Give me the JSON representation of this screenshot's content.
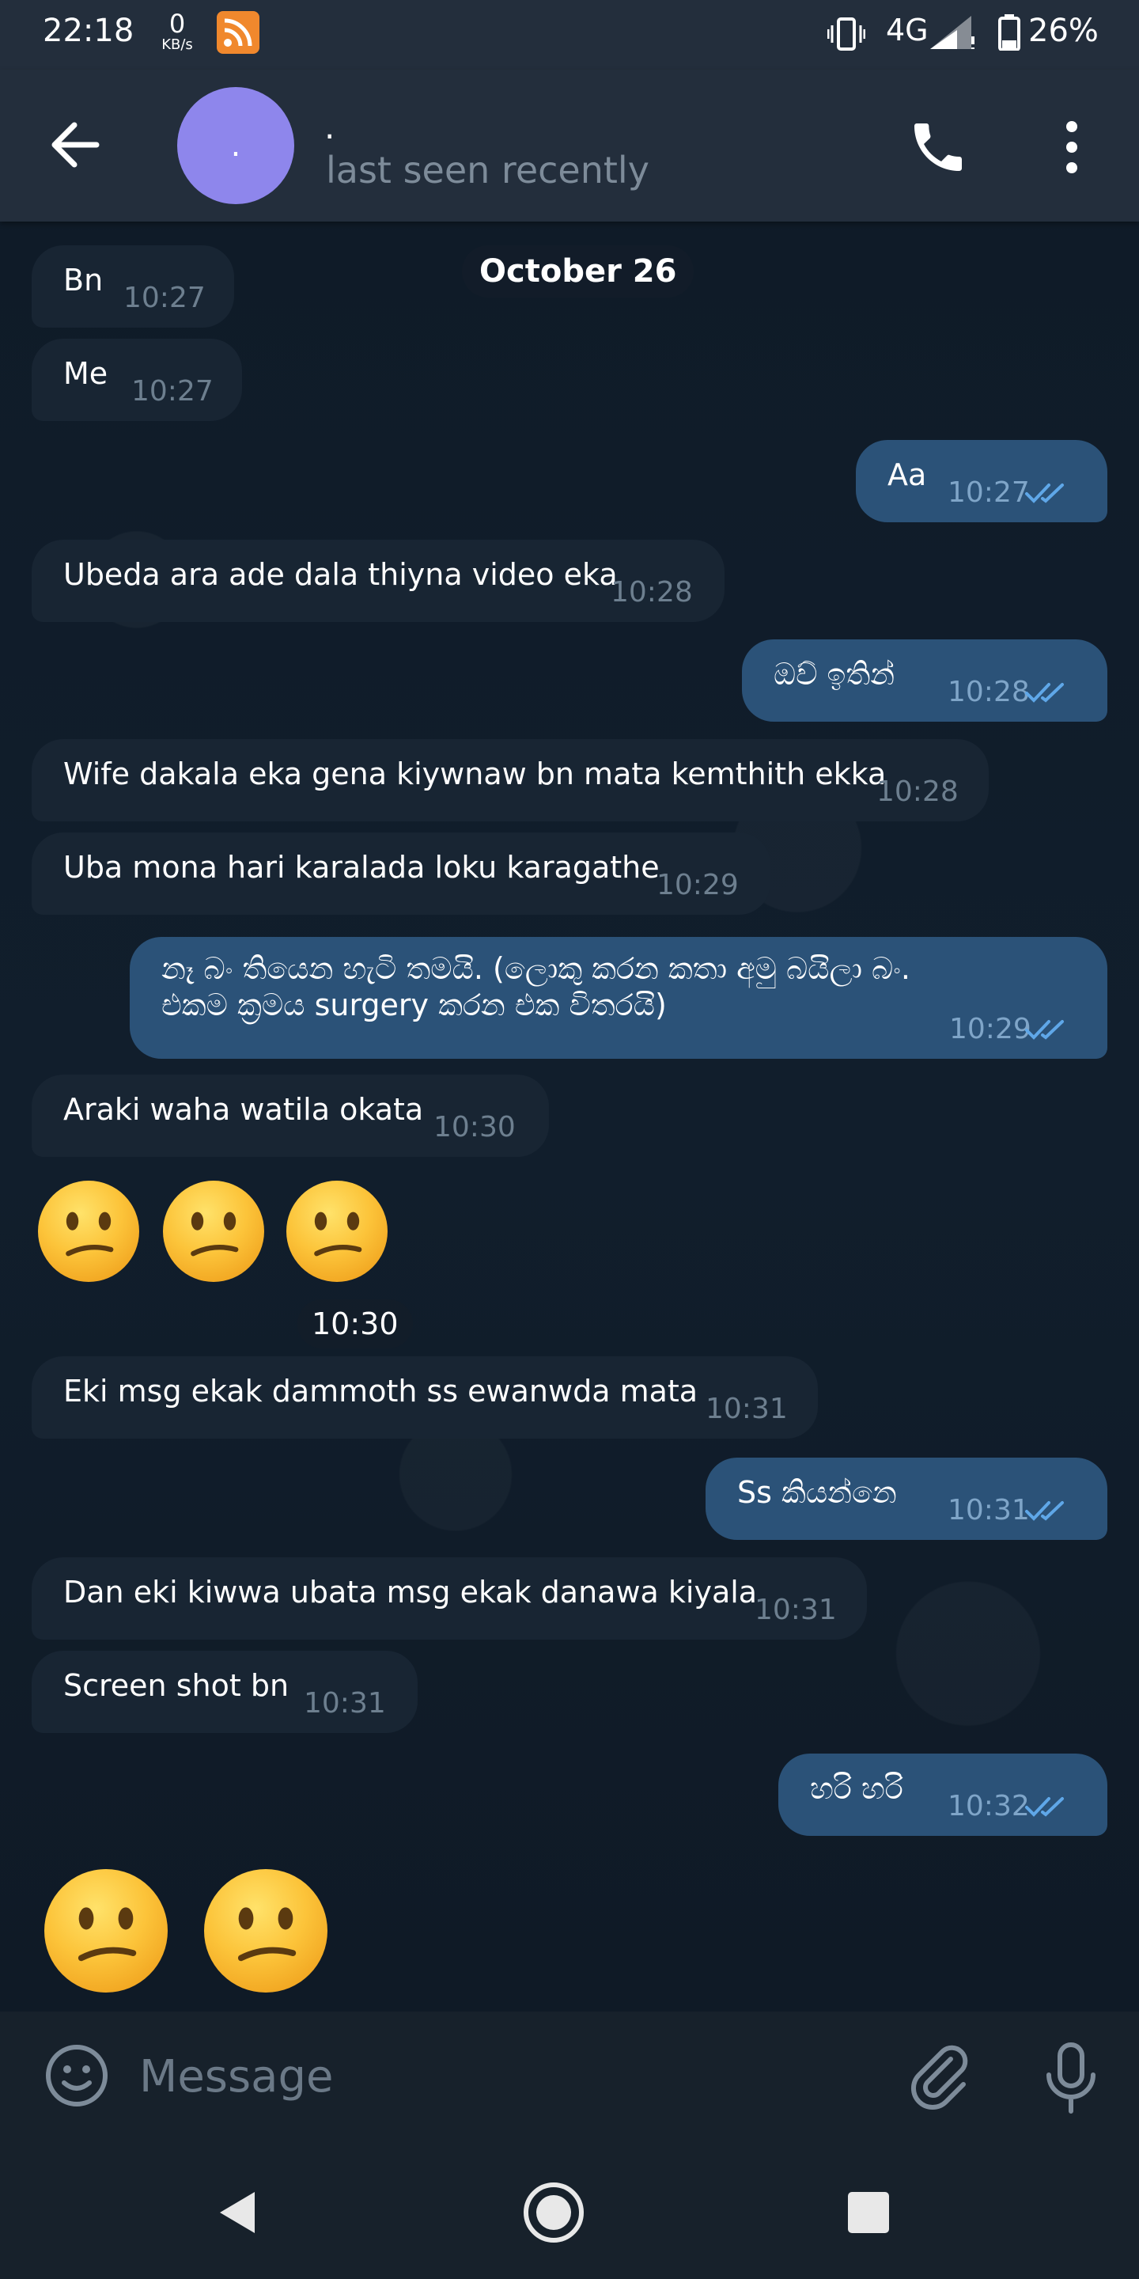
{
  "status_bar": {
    "time": "22:18",
    "net_speed_value": "0",
    "net_speed_unit": "KB/s",
    "network_type": "4G",
    "battery_percent": "26%"
  },
  "header": {
    "avatar_text": ".",
    "name": ".",
    "status": "last seen recently",
    "avatar_color": "#8e86ec"
  },
  "chat": {
    "date_label": "October 26",
    "messages": [
      {
        "dir": "in",
        "text": "Bn",
        "time": "10:27"
      },
      {
        "dir": "in",
        "text": "Me",
        "time": "10:27"
      },
      {
        "dir": "out",
        "text": "Aa",
        "time": "10:27",
        "read": true
      },
      {
        "dir": "in",
        "text": "Ubeda ara ade dala thiyna video eka",
        "time": "10:28"
      },
      {
        "dir": "out",
        "text": "ඔව් ඉතින්",
        "time": "10:28",
        "read": true
      },
      {
        "dir": "in",
        "text": "Wife dakala eka gena kiywnaw bn mata kemthith ekka",
        "time": "10:28"
      },
      {
        "dir": "in",
        "text": "Uba mona hari karalada loku karagathe",
        "time": "10:29"
      },
      {
        "dir": "out",
        "text": "නෑ බං තියෙන හැටි තමයි. (ලොකු කරන කතා අමු බයිලා බං.",
        "text2": "එකම ක්‍රමය surgery කරන එක විතරයි)",
        "time": "10:29",
        "read": true
      },
      {
        "dir": "in",
        "text": "Araki waha watila okata",
        "time": "10:30"
      },
      {
        "dir": "in",
        "emoji": "confused-face",
        "count": 3,
        "time": "10:30"
      },
      {
        "dir": "in",
        "text": "Eki msg ekak dammoth ss ewanwda mata",
        "time": "10:31"
      },
      {
        "dir": "out",
        "text": "Ss කියන්නෙ",
        "time": "10:31",
        "read": true
      },
      {
        "dir": "in",
        "text": "Dan eki kiwwa ubata msg ekak danawa kiyala",
        "time": "10:31"
      },
      {
        "dir": "in",
        "text": "Screen shot bn",
        "time": "10:31"
      },
      {
        "dir": "out",
        "text": "හරි හරි",
        "time": "10:32",
        "read": true
      },
      {
        "dir": "in",
        "emoji": "confused-face",
        "count": 2
      }
    ]
  },
  "input": {
    "placeholder": "Message"
  },
  "colors": {
    "incoming_bubble": "#182533",
    "outgoing_bubble": "#2b5278",
    "header_bg": "#232e3c",
    "read_check": "#5fa7e8"
  },
  "icons": [
    "back-arrow-icon",
    "phone-icon",
    "more-vert-icon",
    "smile-icon",
    "paperclip-icon",
    "microphone-icon",
    "double-check-icon",
    "confused-face-emoji"
  ]
}
